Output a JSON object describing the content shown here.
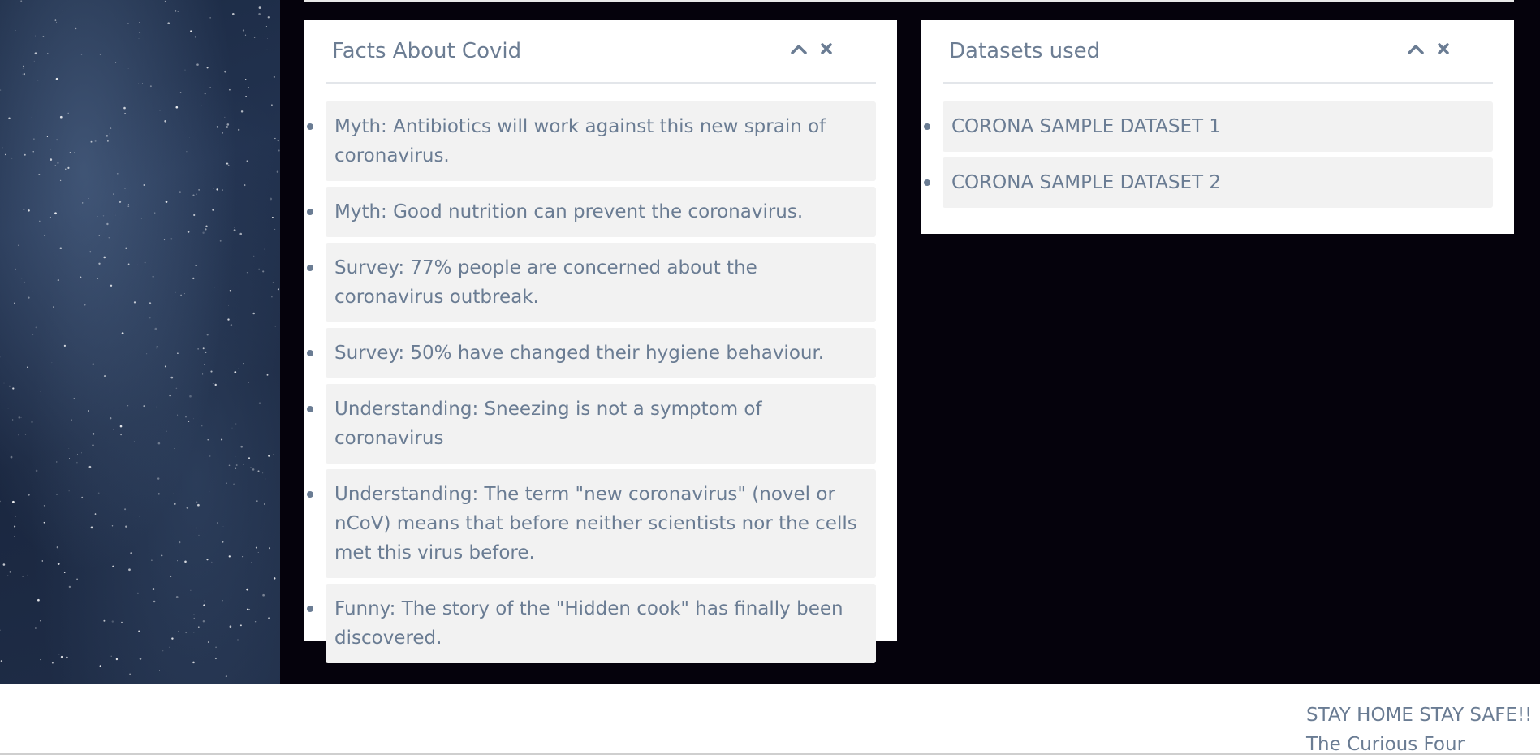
{
  "facts_panel": {
    "title": "Facts About Covid",
    "items": [
      "Myth: Antibiotics will work against this new sprain of coronavirus.",
      "Myth: Good nutrition can prevent the coronavirus.",
      "Survey: 77% people are concerned about the coronavirus outbreak.",
      "Survey: 50% have changed their hygiene behaviour.",
      "Understanding: Sneezing is not a symptom of coronavirus",
      "Understanding: The term \"new coronavirus\" (novel or nCoV) means that before neither scientists nor the cells met this virus before.",
      "Funny: The story of the \"Hidden cook\" has finally been discovered."
    ],
    "collapse_icon": "chevron-up-icon",
    "close_icon": "close-icon"
  },
  "datasets_panel": {
    "title": "Datasets used",
    "items": [
      "CORONA SAMPLE DATASET 1",
      "CORONA SAMPLE DATASET 2"
    ],
    "collapse_icon": "chevron-up-icon",
    "close_icon": "close-icon"
  },
  "footer": {
    "line1": "STAY HOME STAY SAFE!!",
    "line2": "The Curious Four"
  },
  "colors": {
    "text": "#6a7c93",
    "item_background": "#f2f2f2",
    "main_background": "#05020c",
    "panel_background": "#ffffff"
  }
}
